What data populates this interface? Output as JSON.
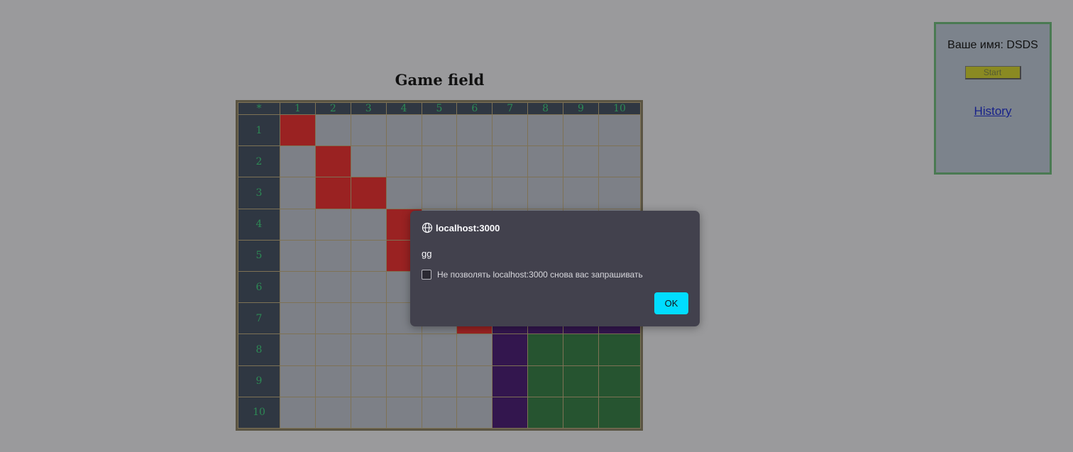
{
  "game": {
    "title": "Game field",
    "corner": "*",
    "columns": [
      "1",
      "2",
      "3",
      "4",
      "5",
      "6",
      "7",
      "8",
      "9",
      "10"
    ],
    "rows": [
      "1",
      "2",
      "3",
      "4",
      "5",
      "6",
      "7",
      "8",
      "9",
      "10"
    ],
    "grid": [
      [
        "red",
        "empty",
        "empty",
        "empty",
        "empty",
        "empty",
        "empty",
        "empty",
        "empty",
        "empty"
      ],
      [
        "empty",
        "red",
        "empty",
        "empty",
        "empty",
        "empty",
        "empty",
        "empty",
        "empty",
        "empty"
      ],
      [
        "empty",
        "red",
        "red",
        "empty",
        "empty",
        "empty",
        "empty",
        "empty",
        "empty",
        "empty"
      ],
      [
        "empty",
        "empty",
        "empty",
        "red",
        "empty",
        "empty",
        "empty",
        "empty",
        "empty",
        "empty"
      ],
      [
        "empty",
        "empty",
        "empty",
        "red",
        "empty",
        "empty",
        "empty",
        "empty",
        "empty",
        "empty"
      ],
      [
        "empty",
        "empty",
        "empty",
        "empty",
        "empty",
        "empty",
        "empty",
        "empty",
        "empty",
        "empty"
      ],
      [
        "empty",
        "empty",
        "empty",
        "empty",
        "empty",
        "red",
        "purple",
        "purple",
        "purple",
        "purple"
      ],
      [
        "empty",
        "empty",
        "empty",
        "empty",
        "empty",
        "empty",
        "purple",
        "green",
        "green",
        "green"
      ],
      [
        "empty",
        "empty",
        "empty",
        "empty",
        "empty",
        "empty",
        "purple",
        "green",
        "green",
        "green"
      ],
      [
        "empty",
        "empty",
        "empty",
        "empty",
        "empty",
        "empty",
        "purple",
        "green",
        "green",
        "green"
      ]
    ],
    "colors": {
      "red": "#9a2222",
      "purple": "#33164e",
      "green": "#265430",
      "empty": "#7d8087",
      "header": "#2f3742",
      "label": "#2d8a55"
    }
  },
  "panel": {
    "name_label": "Ваше имя: DSDS",
    "start_label": "Start",
    "history_label": "History"
  },
  "dialog": {
    "origin": "localhost:3000",
    "message": "gg",
    "checkbox_label": "Не позволять localhost:3000 снова вас запрашивать",
    "ok_label": "OK",
    "accent": "#00ddff"
  }
}
